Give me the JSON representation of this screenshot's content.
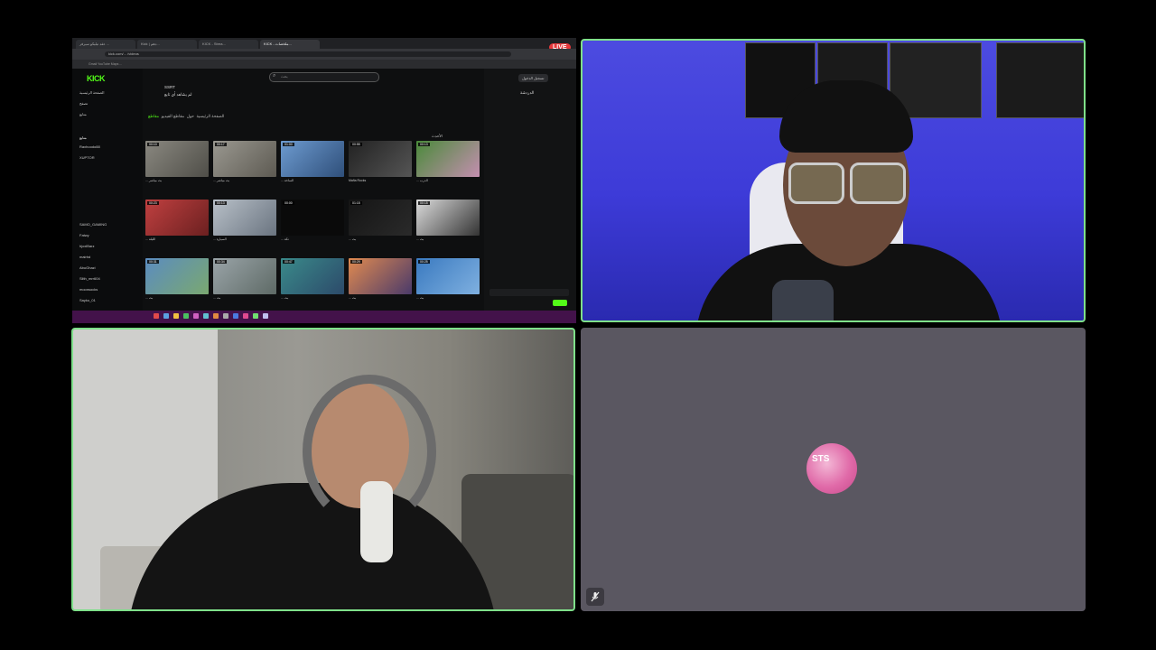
{
  "screen_share": {
    "browser_tabs": [
      "عقد تيليكو سيرفر ...",
      "Kick | دهم...",
      "KICK - Strea...",
      "KICK - ملخصات..."
    ],
    "url": "kick.com/... /videos",
    "bookmarks": "Gmail   YouTube   Maps   ...",
    "live_badge": "LIVE",
    "kick": {
      "logo": "KICK",
      "sidebar_items": [
        "الصفحة الرئيسية",
        "تصفح",
        "متابع"
      ],
      "following_header": "متابع",
      "channels": [
        "Raxhoodo88",
        "XUPTOR",
        "SAMO_GAMING",
        "Fatwy",
        "hjoxlBarz",
        "mairhd",
        "AbuGhazi",
        "Slith_mrr604",
        "moonsocks",
        "Sayko_01"
      ],
      "search_placeholder": "بحث",
      "channel_name": "SSRT",
      "channel_subtitle": "لم يشاهد أي تابع",
      "tabs": [
        "الصفحة الرئيسية",
        "حول",
        "مقاطع الفيديو",
        "مقاطع"
      ],
      "sort_label": "الأحدث",
      "login_button": "تسجيل الدخول",
      "chat_title": "الدردشة",
      "videos": [
        {
          "duration": "00:10",
          "title": "... بث مباشر"
        },
        {
          "duration": "00:17",
          "title": "... بث مباشر"
        },
        {
          "duration": "01:00",
          "title": "... الساحة"
        },
        {
          "duration": "00:55",
          "title": "Mafia Rocks"
        },
        {
          "duration": "00:13",
          "title": "... الدرب"
        },
        {
          "duration": "00:23",
          "title": "... الليلة"
        },
        {
          "duration": "00:13",
          "title": "... السيارة"
        },
        {
          "duration": "00:00",
          "title": "... تكة"
        },
        {
          "duration": "01:15",
          "title": "... بث"
        },
        {
          "duration": "00:15",
          "title": "... بث"
        },
        {
          "duration": "00:31",
          "title": "... بث"
        },
        {
          "duration": "00:34",
          "title": "... بث"
        },
        {
          "duration": "00:47",
          "title": "... بث"
        },
        {
          "duration": "00:29",
          "title": "... بث"
        },
        {
          "duration": "00:25",
          "title": "... بث"
        }
      ]
    }
  },
  "tiles": {
    "avatar_sticker": "STS",
    "mute_icon": "mic-off-icon"
  }
}
